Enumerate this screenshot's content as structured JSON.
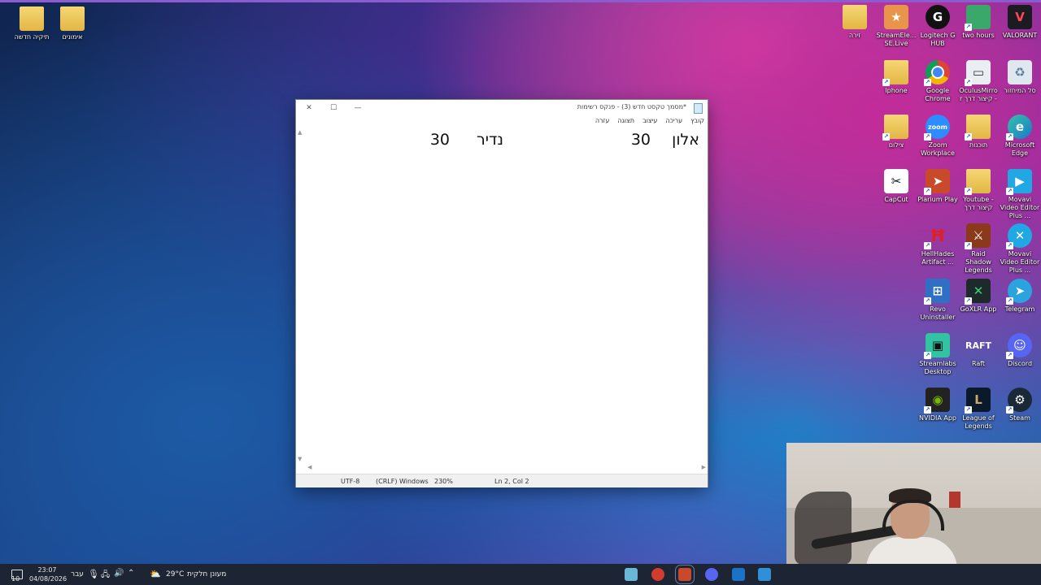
{
  "desktop": {
    "left_icons": [
      {
        "label": "תיקיה חדשה",
        "icon": "folder-icon"
      },
      {
        "label": "אימונים",
        "icon": "folder-icon"
      }
    ],
    "right_icons": [
      {
        "label": "VALORANT",
        "icon": "valorant-icon"
      },
      {
        "label": "two hours",
        "icon": "image-shortcut-icon"
      },
      {
        "label": "Logitech G HUB",
        "icon": "logitech-icon"
      },
      {
        "label": "StreamEle... SE.Live",
        "icon": "streamelements-icon"
      },
      {
        "label": "זירה",
        "icon": "folder-icon"
      },
      {
        "label": "סל המיחזור",
        "icon": "recycle-bin-icon"
      },
      {
        "label": "OculusMirror קיצור דרך -",
        "icon": "oculus-mirror-icon"
      },
      {
        "label": "Google Chrome",
        "icon": "chrome-icon"
      },
      {
        "label": "Iphone",
        "icon": "folder-icon"
      },
      {
        "label": "Microsoft Edge",
        "icon": "edge-icon"
      },
      {
        "label": "תוכנות",
        "icon": "folder-icon"
      },
      {
        "label": "Zoom Workplace",
        "icon": "zoom-icon"
      },
      {
        "label": "צילום",
        "icon": "folder-icon"
      },
      {
        "label": "Movavi Video Editor Plus ...",
        "icon": "movavi-icon"
      },
      {
        "label": "Youtube - קיצור דרך",
        "icon": "folder-icon"
      },
      {
        "label": "Plarium Play",
        "icon": "plarium-icon"
      },
      {
        "label": "CapCut",
        "icon": "capcut-icon"
      },
      {
        "label": "Movavi Video Editor Plus ...",
        "icon": "movavi-icon"
      },
      {
        "label": "Raid Shadow Legends",
        "icon": "raid-icon"
      },
      {
        "label": "HellHades Artifact ...",
        "icon": "hellhades-icon"
      },
      {
        "label": "Telegram",
        "icon": "telegram-icon"
      },
      {
        "label": "GoXLR App",
        "icon": "goxlr-icon"
      },
      {
        "label": "Revo Uninstaller",
        "icon": "revo-icon"
      },
      {
        "label": "Discord",
        "icon": "discord-icon"
      },
      {
        "label": "Raft",
        "icon": "raft-icon"
      },
      {
        "label": "Streamlabs Desktop",
        "icon": "streamlabs-icon"
      },
      {
        "label": "Steam",
        "icon": "steam-icon"
      },
      {
        "label": "League of Legends",
        "icon": "league-icon"
      },
      {
        "label": "NVIDIA App",
        "icon": "nvidia-icon"
      }
    ]
  },
  "notepad": {
    "title": "*מסמך טקסט חדש (3) - פנקס רשימות",
    "menu": [
      "קובץ",
      "עריכה",
      "עיצוב",
      "תצוגה",
      "עזרה"
    ],
    "content": {
      "word1": "אלון",
      "num1": "30",
      "word2": "נדיר",
      "num2": "30"
    },
    "status": {
      "position": "Ln 2, Col 2",
      "zoom": "230%",
      "line_ending": "(CRLF) Windows",
      "encoding": "UTF-8"
    }
  },
  "taskbar": {
    "notification_count": "10",
    "time": "23:07",
    "date": "04/08/2026",
    "language": "עבר",
    "weather_temp": "29°C",
    "weather_text": "מעונן חלקית"
  },
  "colors": {
    "taskbar": "#1d2433",
    "accent": "#0078d4"
  }
}
